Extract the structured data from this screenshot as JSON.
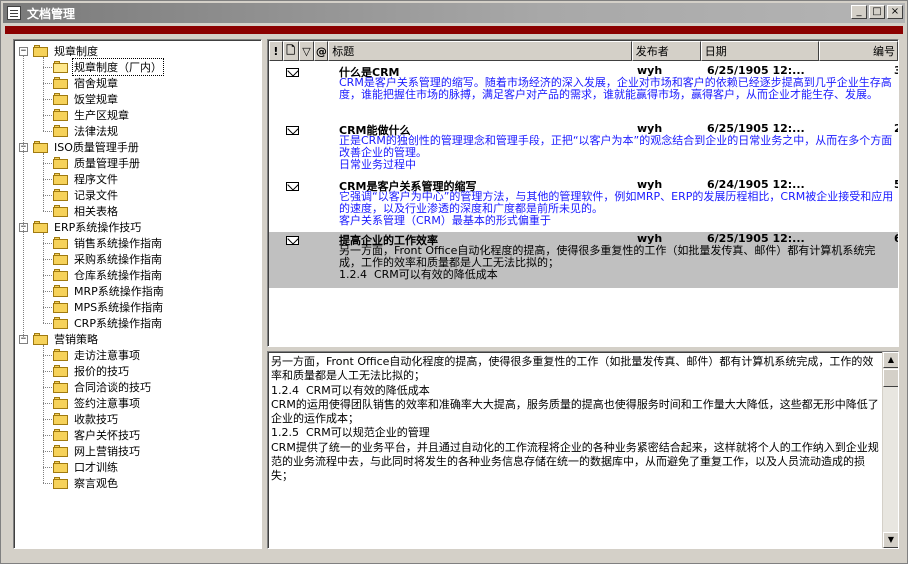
{
  "window": {
    "title": "文档管理"
  },
  "titlebar_buttons": {
    "minimize": "_",
    "maximize": "□",
    "close": "×"
  },
  "tree": [
    {
      "label": "规章制度",
      "level": 0,
      "expander": "−"
    },
    {
      "label": "规章制度（厂内）",
      "level": 1,
      "selected": true
    },
    {
      "label": "宿舍规章",
      "level": 1
    },
    {
      "label": "饭堂规章",
      "level": 1
    },
    {
      "label": "生产区规章",
      "level": 1
    },
    {
      "label": "法律法规",
      "level": 1
    },
    {
      "label": "ISO质量管理手册",
      "level": 0,
      "expander": "−"
    },
    {
      "label": "质量管理手册",
      "level": 1
    },
    {
      "label": "程序文件",
      "level": 1
    },
    {
      "label": "记录文件",
      "level": 1
    },
    {
      "label": "相关表格",
      "level": 1
    },
    {
      "label": "ERP系统操作技巧",
      "level": 0,
      "expander": "−"
    },
    {
      "label": "销售系统操作指南",
      "level": 1
    },
    {
      "label": "采购系统操作指南",
      "level": 1
    },
    {
      "label": "仓库系统操作指南",
      "level": 1
    },
    {
      "label": "MRP系统操作指南",
      "level": 1
    },
    {
      "label": "MPS系统操作指南",
      "level": 1
    },
    {
      "label": "CRP系统操作指南",
      "level": 1
    },
    {
      "label": "营销策略",
      "level": 0,
      "expander": "−"
    },
    {
      "label": "走访注意事项",
      "level": 1
    },
    {
      "label": "报价的技巧",
      "level": 1
    },
    {
      "label": "合同洽谈的技巧",
      "level": 1
    },
    {
      "label": "签约注意事项",
      "level": 1
    },
    {
      "label": "收款技巧",
      "level": 1
    },
    {
      "label": "客户关怀技巧",
      "level": 1
    },
    {
      "label": "网上营销技巧",
      "level": 1
    },
    {
      "label": "口才训练",
      "level": 1
    },
    {
      "label": "察言观色",
      "level": 1
    }
  ],
  "list": {
    "header_icons": [
      "!",
      "🗋",
      "▽",
      "@"
    ],
    "columns": {
      "title": "标题",
      "publisher": "发布者",
      "date": "日期",
      "number": "编号"
    },
    "messages": [
      {
        "title": "什么是CRM",
        "publisher": "wyh",
        "date": "6/25/1905 12:...",
        "number": "3",
        "preview": "CRM是客户关系管理的缩写。随着市场经济的深入发展，企业对市场和客户的依赖已经逐步提高到几乎企业生存高度，谁能把握住市场的脉搏，满足客户对产品的需求，谁就能赢得市场，赢得客户，从而企业才能生存、发展。"
      },
      {
        "title": "CRM能做什么",
        "publisher": "wyh",
        "date": "6/25/1905 12:...",
        "number": "2",
        "preview": "正是CRM的独创性的管理理念和管理手段，正把“以客户为本”的观念结合到企业的日常业务之中，从而在多个方面改善企业的管理。\n日常业务过程中"
      },
      {
        "title": "CRM是客户关系管理的缩写",
        "publisher": "wyh",
        "date": "6/24/1905 12:...",
        "number": "5",
        "preview": "它强调“以客户为中心”的管理方法，与其他的管理软件，例如MRP、ERP的发展历程相比，CRM被企业接受和应用的速度，以及行业渗透的深度和广度都是前所未见的。\n客户关系管理（CRM）最基本的形式偏重于"
      },
      {
        "title": "提高企业的工作效率",
        "publisher": "wyh",
        "date": "6/25/1905 12:...",
        "number": "6",
        "selected": true,
        "preview": "另一方面，Front Office自动化程度的提高，使得很多重复性的工作（如批量发传真、邮件）都有计算机系统完成，工作的效率和质量都是人工无法比拟的；\n1.2.4  CRM可以有效的降低成本"
      }
    ]
  },
  "detail": {
    "text": "另一方面，Front Office自动化程度的提高，使得很多重复性的工作（如批量发传真、邮件）都有计算机系统完成，工作的效率和质量都是人工无法比拟的；\n1.2.4  CRM可以有效的降低成本\nCRM的运用使得团队销售的效率和准确率大大提高，服务质量的提高也使得服务时间和工作量大大降低，这些都无形中降低了企业的运作成本；\n1.2.5  CRM可以规范企业的管理\nCRM提供了统一的业务平台，并且通过自动化的工作流程将企业的各种业务紧密结合起来，这样就将个人的工作纳入到企业规范的业务流程中去，与此同时将发生的各种业务信息存储在统一的数据库中，从而避免了重复工作，以及人员流动造成的损失；"
  },
  "scrollbar": {
    "up": "▲",
    "down": "▼"
  }
}
